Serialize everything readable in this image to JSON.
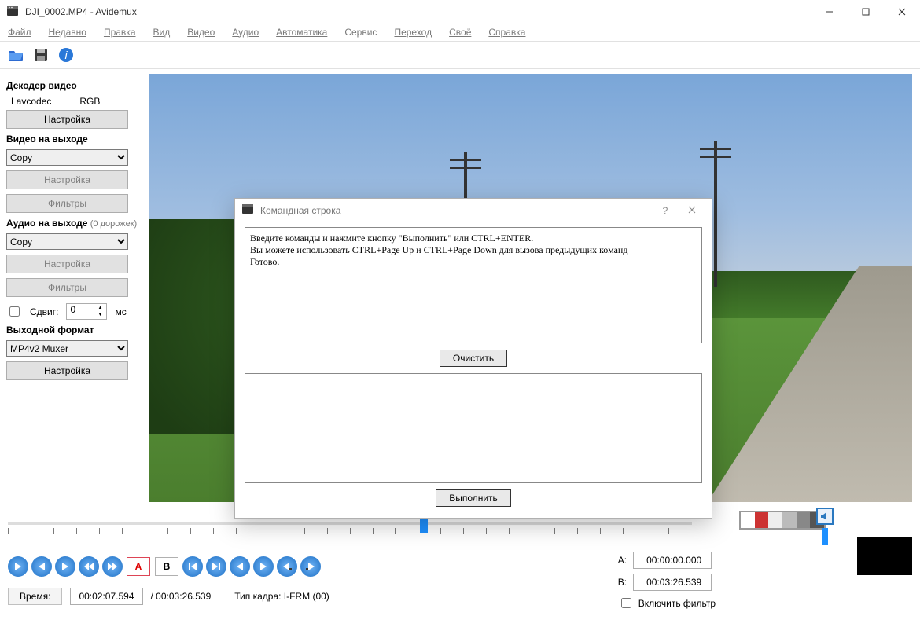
{
  "titlebar": {
    "text": "DJI_0002.MP4 - Avidemux"
  },
  "menu": {
    "file": "Файл",
    "recent": "Недавно",
    "edit": "Правка",
    "view": "Вид",
    "video": "Видео",
    "audio": "Аудио",
    "auto": "Автоматика",
    "service": "Сервис",
    "go": "Переход",
    "custom": "Своё",
    "help": "Справка"
  },
  "sidebar": {
    "decoder_title": "Декодер видео",
    "decoder_codec": "Lavcodec",
    "decoder_color": "RGB",
    "configure": "Настройка",
    "video_out_title": "Видео на выходе",
    "video_out_value": "Copy",
    "filters": "Фильтры",
    "audio_out_title": "Аудио на выходе",
    "audio_tracks": "(0 дорожек)",
    "audio_out_value": "Copy",
    "shift_label": "Сдвиг:",
    "shift_value": "0",
    "shift_unit": "мс",
    "outfmt_title": "Выходной формат",
    "outfmt_value": "MP4v2 Muxer"
  },
  "modal": {
    "title": "Командная строка",
    "log": "Введите команды и нажмите кнопку \"Выполнить\" или CTRL+ENTER.\nВы можете использовать CTRL+Page Up и CTRL+Page Down для вызова предыдущих команд\nГотово.",
    "clear": "Очистить",
    "input": "",
    "run": "Выполнить"
  },
  "footer": {
    "a_label": "A:",
    "a_value": "00:00:00.000",
    "b_label": "B:",
    "b_value": "00:03:26.539",
    "filter_label": "Включить фильтр",
    "time_label": "Время:",
    "time_value": "00:02:07.594",
    "total": "/ 00:03:26.539",
    "frame_type": "Тип кадра:  I-FRM (00)"
  }
}
